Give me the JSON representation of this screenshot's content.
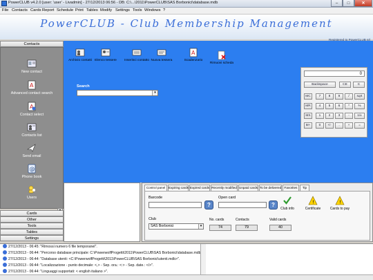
{
  "window": {
    "title": "PowerCLUB v4.2.0   [user: 'user' - Livadmin] - 27/12/2013 06:56 - DB: C:\\...\\2011\\PowerCLUB\\SAS Borbonici\\database.mdb",
    "min_label": "–",
    "max_label": "□",
    "close_label": "✕"
  },
  "menu": [
    "File",
    "Contacts",
    "Cards",
    "Report",
    "Schedule",
    "Print",
    "Tables",
    "Modify",
    "Settings",
    "Tools",
    "Windows",
    "?"
  ],
  "header": {
    "title": "PowerCLUB - Club Membership Management",
    "subtitle": "Registered to PowerCLUB srl"
  },
  "sidebar": {
    "head": "Contacts",
    "items": [
      {
        "label": "New contact",
        "icon": "new-contact-icon"
      },
      {
        "label": "Advanced contact search",
        "icon": "advanced-search-icon"
      },
      {
        "label": "Contact select",
        "icon": "contact-select-icon"
      },
      {
        "label": "Contacts list",
        "icon": "contacts-list-icon"
      },
      {
        "label": "Send email",
        "icon": "send-email-icon"
      },
      {
        "label": "Phone book",
        "icon": "phone-book-icon"
      },
      {
        "label": "Users",
        "icon": "users-icon"
      }
    ],
    "sections": [
      "Cards",
      "Other",
      "Tools",
      "Tables",
      "Settings"
    ]
  },
  "toolbar": [
    {
      "label": "Archivio contatti",
      "icon": "archive-contacts-icon"
    },
    {
      "label": "Elenco tessere",
      "icon": "card-list-icon"
    },
    {
      "label": "Inserisci contatto",
      "icon": "insert-contact-icon"
    },
    {
      "label": "Nuova tessera",
      "icon": "new-card-icon"
    },
    {
      "label": "Scadenzario",
      "icon": "schedule-icon"
    },
    {
      "label": "Rimuovi scheda",
      "icon": "remove-card-icon"
    }
  ],
  "search": {
    "label": "Search",
    "value": ""
  },
  "calculator": {
    "display": "0",
    "top_buttons": [
      "Backspace",
      "CE",
      "C"
    ],
    "rows": [
      [
        "MC",
        "7",
        "8",
        "9",
        "/",
        "sqrt"
      ],
      [
        "MR",
        "4",
        "5",
        "6",
        "*",
        "%"
      ],
      [
        "MS",
        "1",
        "2",
        "3",
        "-",
        "1/x"
      ],
      [
        "M+",
        "0",
        "+/-",
        ".",
        "+",
        "="
      ]
    ]
  },
  "tabs": [
    "Control panel",
    "Expiring cards",
    "Expired cards",
    "Recently modified",
    "Unpaid cards",
    "To be delivered",
    "Favorites",
    "Tip"
  ],
  "control_panel": {
    "barcode_label": "Barcode",
    "open_card_label": "Open card",
    "club_label": "Club",
    "club_value": "SAS Borbonici",
    "no_cards_label": "No. cards",
    "no_cards_value": "74",
    "contacts_label": "Contacts",
    "contacts_value": "79",
    "valid_cards_label": "Valid cards",
    "valid_cards_value": "40",
    "actions": [
      {
        "label": "Club info",
        "icon": "check-icon"
      },
      {
        "label": "Certificate",
        "icon": "warning-icon"
      },
      {
        "label": "Cards to pay",
        "icon": "warning-icon"
      }
    ]
  },
  "log": [
    "27/12/2013 - 06:45: \"Rimossi numero 6 file temporanei\".",
    "27/12/2013 - 06:44: \"Percorso database principale: C:\\PowerwolfProgetti\\2011\\PowerCLUB\\SAS Borbonici\\database.mdb\".",
    "27/12/2013 - 06:44: \"Database utenti: <C:\\PowerwolfProgetti\\2011\\PowerCLUB\\SAS Borbonici\\utenti.mdb>\".",
    "27/12/2013 - 06:44: \"Localizzazione - punto decimale: <,> - Sep. ora.: <:> - Sep. date.: </>\".",
    "27/12/2013 - 06:44: \"Linguaggi supportati: < english italiano >\"."
  ]
}
